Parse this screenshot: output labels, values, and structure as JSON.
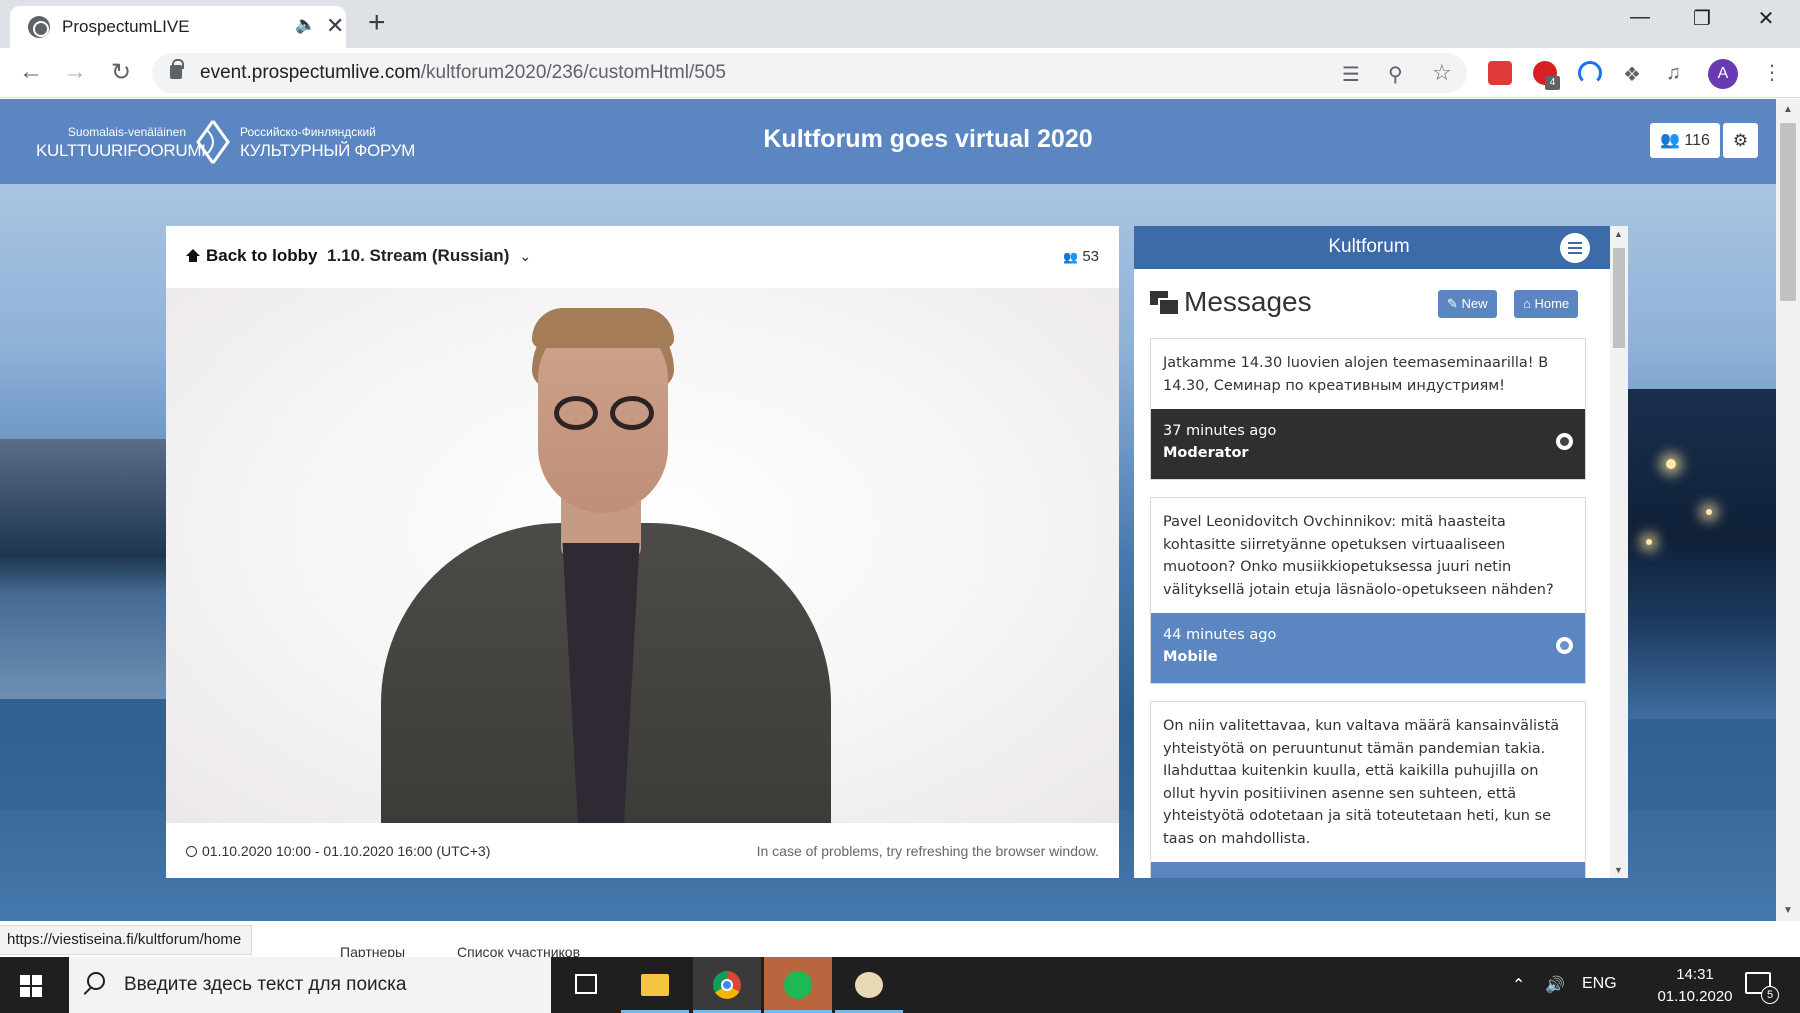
{
  "browser": {
    "tab_title": "ProspectumLIVE",
    "url_host": "event.prospectumlive.com",
    "url_path": "/kultforum2020/236/customHtml/505",
    "extension_badge": "4",
    "profile_initial": "A"
  },
  "app": {
    "logo_fi_small": "Suomalais-venäläinen",
    "logo_fi_big": "KULTTUURIFOORUMI",
    "logo_ru_small": "Российско-Финляндский",
    "logo_ru_big": "КУЛЬТУРНЫЙ ФОРУМ",
    "event_title": "Kultforum goes virtual 2020",
    "online_count": "116"
  },
  "stream": {
    "back_label": "Back to lobby",
    "stream_name": "1.10. Stream (Russian)",
    "viewers": "53",
    "schedule": "01.10.2020 10:00 - 01.10.2020 16:00 (UTC+3)",
    "help_text": "In case of problems, try refreshing the browser window."
  },
  "chat": {
    "header": "Kultforum",
    "title": "Messages",
    "new_label": "New",
    "home_label": "Home",
    "messages": [
      {
        "text": "Jatkamme 14.30 luovien alojen teemaseminaarilla! В 14.30, Семинар по креативным индустриям!",
        "time": "37 minutes ago",
        "author": "Moderator",
        "style": "dark"
      },
      {
        "text": "Pavel Leonidovitch Ovchinnikov: mitä haasteita kohtasitte siirretyänne opetuksen virtuaaliseen muotoon? Onko musiikkiopetuksessa juuri netin välityksellä jotain etuja läsnäolo-opetukseen nähden?",
        "time": "44 minutes ago",
        "author": "Mobile",
        "style": "blue"
      },
      {
        "text": "On niin valitettavaa, kun valtava määrä kansainvälistä yhteistyötä on peruuntunut tämän pandemian takia. Ilahduttaa kuitenkin kuulla, että kaikilla puhujilla on ollut hyvin positiivinen asenne sen suhteen, että yhteistyötä odotetaan ja sitä toteutetaan heti, kun se taas on mahdollista.",
        "time": "",
        "author": "",
        "style": "blue"
      }
    ]
  },
  "subnav": {
    "item_1": "Партнеры",
    "item_2": "Список участников"
  },
  "status_link": "https://viestiseina.fi/kultforum/home",
  "taskbar": {
    "search_placeholder": "Введите здесь текст для поиска",
    "lang": "ENG",
    "time": "14:31",
    "date": "01.10.2020",
    "notifications": "5"
  },
  "colors": {
    "header_blue": "#5b86c1",
    "chat_header": "#3d6aa8",
    "moderator_footer": "#2f2f2f"
  }
}
